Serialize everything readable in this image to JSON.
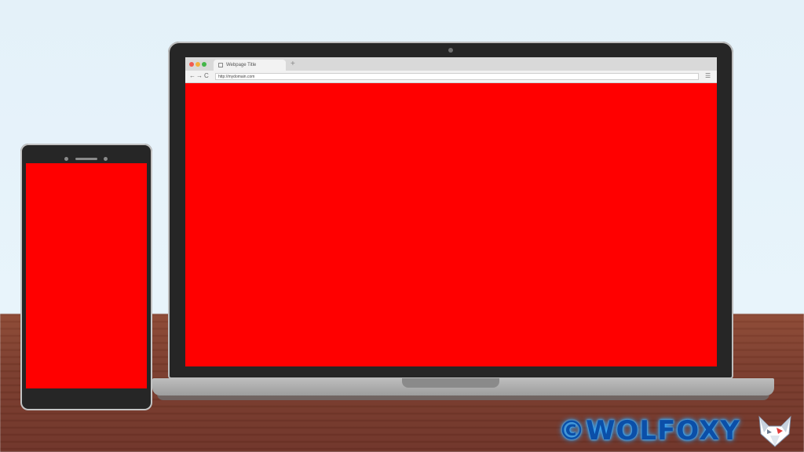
{
  "browser": {
    "tab_title": "Webpage Title",
    "new_tab": "+",
    "back": "←",
    "forward": "→",
    "reload": "C",
    "address": "http://mydomain.com",
    "menu": "☰"
  },
  "watermark": {
    "text": "©WOLFOXY"
  },
  "colors": {
    "screen": "#ff0000",
    "wall": "#e6f3fa",
    "table": "#7a3b2b",
    "device_frame": "#262626"
  }
}
